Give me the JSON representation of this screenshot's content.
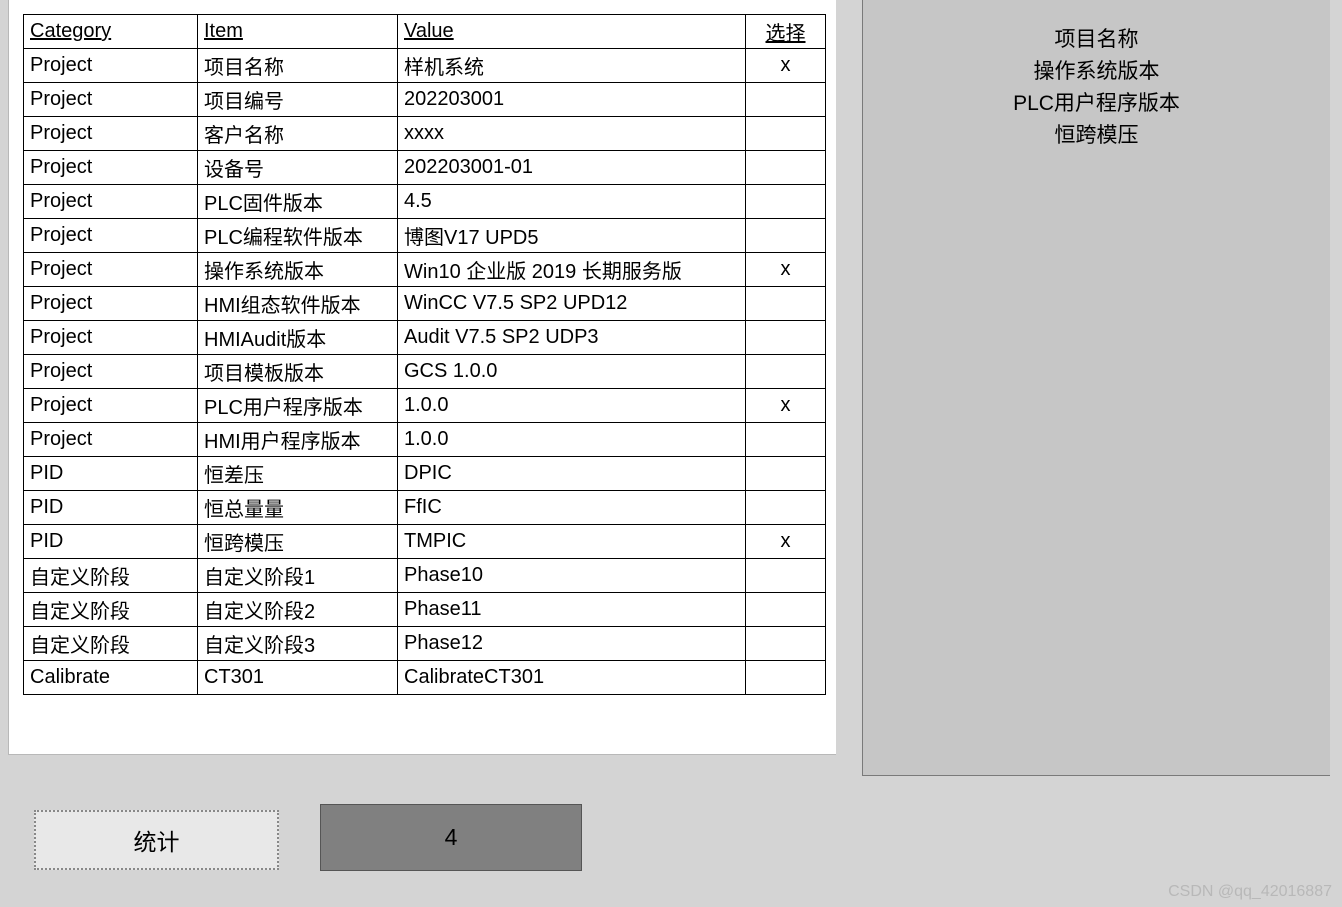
{
  "table": {
    "headers": {
      "category": "Category",
      "item": "Item",
      "value": "Value",
      "select": "选择"
    },
    "rows": [
      {
        "category": "Project",
        "item": "项目名称",
        "value": "样机系统",
        "select": "x"
      },
      {
        "category": "Project",
        "item": "项目编号",
        "value": "202203001",
        "select": ""
      },
      {
        "category": "Project",
        "item": "客户名称",
        "value": "xxxx",
        "select": ""
      },
      {
        "category": "Project",
        "item": "设备号",
        "value": "202203001-01",
        "select": ""
      },
      {
        "category": "Project",
        "item": "PLC固件版本",
        "value": "4.5",
        "select": ""
      },
      {
        "category": "Project",
        "item": "PLC编程软件版本",
        "value": "博图V17 UPD5",
        "select": ""
      },
      {
        "category": "Project",
        "item": "操作系统版本",
        "value": "Win10 企业版 2019 长期服务版",
        "select": "x"
      },
      {
        "category": "Project",
        "item": "HMI组态软件版本",
        "value": "WinCC V7.5 SP2 UPD12",
        "select": ""
      },
      {
        "category": "Project",
        "item": "HMIAudit版本",
        "value": "Audit V7.5 SP2 UDP3",
        "select": ""
      },
      {
        "category": "Project",
        "item": "项目模板版本",
        "value": "GCS 1.0.0",
        "select": ""
      },
      {
        "category": "Project",
        "item": "PLC用户程序版本",
        "value": "1.0.0",
        "select": "x"
      },
      {
        "category": "Project",
        "item": "HMI用户程序版本",
        "value": "1.0.0",
        "select": ""
      },
      {
        "category": "PID",
        "item": "恒差压",
        "value": "DPIC",
        "select": ""
      },
      {
        "category": "PID",
        "item": "恒总量量",
        "value": "FfIC",
        "select": ""
      },
      {
        "category": "PID",
        "item": "恒跨模压",
        "value": "TMPIC",
        "select": "x"
      },
      {
        "category": "自定义阶段",
        "item": "自定义阶段1",
        "value": "Phase10",
        "select": ""
      },
      {
        "category": "自定义阶段",
        "item": "自定义阶段2",
        "value": "Phase11",
        "select": ""
      },
      {
        "category": "自定义阶段",
        "item": "自定义阶段3",
        "value": "Phase12",
        "select": ""
      },
      {
        "category": "Calibrate",
        "item": "CT301",
        "value": "CalibrateCT301",
        "select": ""
      }
    ]
  },
  "rightPanel": {
    "lines": [
      "项目名称",
      "操作系统版本",
      "PLC用户程序版本",
      "恒跨模压"
    ]
  },
  "buttons": {
    "stat_label": "统计"
  },
  "count_value": "4",
  "watermark": "CSDN @qq_42016887"
}
